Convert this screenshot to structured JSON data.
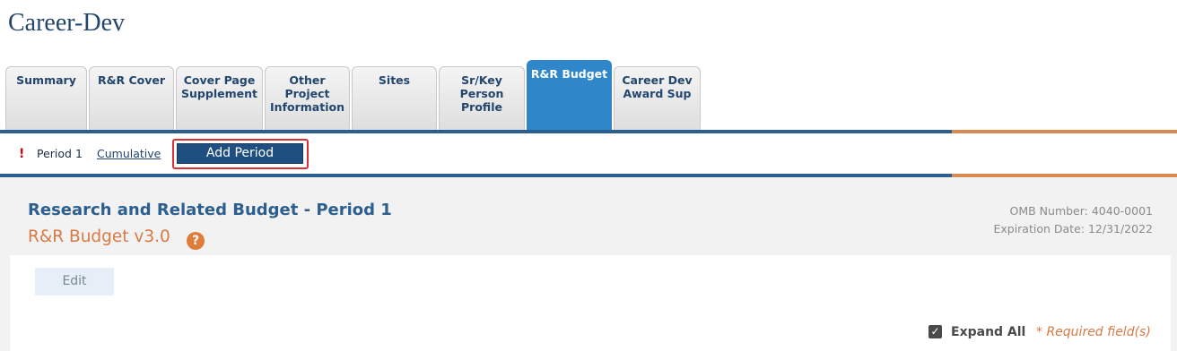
{
  "app": {
    "title": "Career-Dev"
  },
  "tabs": [
    {
      "label": "Summary",
      "active": false
    },
    {
      "label": "R&R Cover",
      "active": false
    },
    {
      "label": "Cover Page\nSupplement",
      "active": false
    },
    {
      "label": "Other\nProject\nInformation",
      "active": false
    },
    {
      "label": "Sites",
      "active": false
    },
    {
      "label": "Sr/Key\nPerson\nProfile",
      "active": false
    },
    {
      "label": "R&R Budget",
      "active": true
    },
    {
      "label": "Career Dev\nAward Sup",
      "active": false
    }
  ],
  "period_bar": {
    "alert_icon": "!",
    "current_period": "Period 1",
    "cumulative_link": "Cumulative",
    "add_period_button": "Add Period"
  },
  "form": {
    "title": "Research and Related Budget - Period 1",
    "version": "R&R Budget v3.0",
    "help_icon": "?",
    "omb_number": "OMB Number: 4040-0001",
    "expiration_date": "Expiration Date: 12/31/2022",
    "edit_button": "Edit",
    "expand_all": {
      "label": "Expand All",
      "checked": true,
      "check_glyph": "✓"
    },
    "required_note": "* Required field(s)"
  },
  "colors": {
    "brand_blue": "#2c5f8f",
    "active_tab": "#2f86c8",
    "accent_orange": "#d98a52",
    "button_navy": "#1f4f80",
    "highlight_red": "#d9303a"
  }
}
